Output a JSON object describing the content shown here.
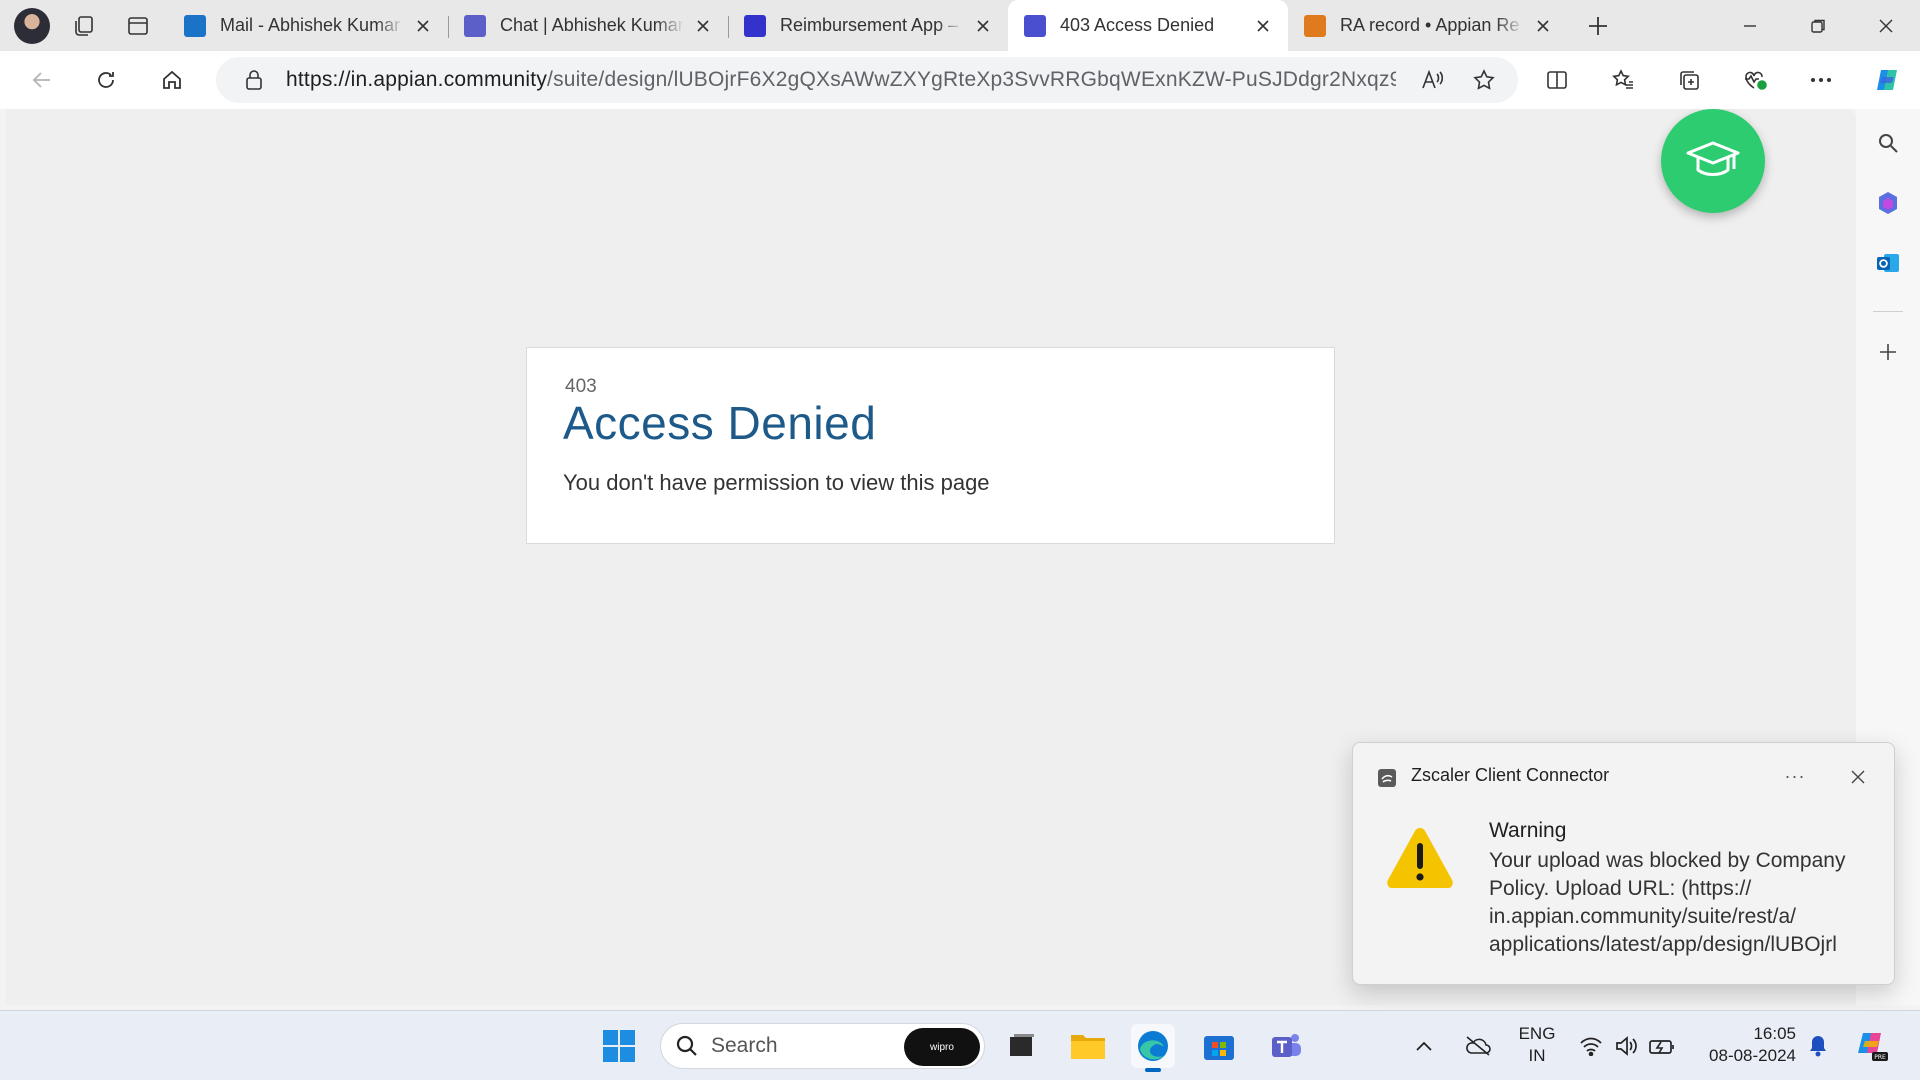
{
  "browser": {
    "tabs": [
      {
        "title": "Mail - Abhishek Kumar",
        "icon": "outlook-icon",
        "color": "#1a73c7"
      },
      {
        "title": "Chat | Abhishek Kumar",
        "icon": "teams-icon",
        "color": "#5b5fc7"
      },
      {
        "title": "Reimbursement App –",
        "icon": "appian-grid-icon",
        "color": "#3333cc"
      },
      {
        "title": "403 Access Denied",
        "icon": "appian-page-icon",
        "color": "#4a4fcf"
      },
      {
        "title": "RA record • Appian Re",
        "icon": "appian-record-icon",
        "color": "#e07a1f"
      }
    ],
    "active_tab_index": 3,
    "url_host": "https://in.appian.community",
    "url_path": "/suite/design/lUBOjrF6X2gQXsAWwZXYgRteXp3SvvRRGbqWExnKZW-PuSJDdgr2Nxqz90..."
  },
  "page": {
    "error_code": "403",
    "error_title": "Access Denied",
    "error_message": "You don't have permission to view this page"
  },
  "toast": {
    "app_name": "Zscaler Client Connector",
    "title": "Warning",
    "body": "Your upload was blocked by Company Policy. Upload URL: (https:// in.appian.community/suite/rest/a/ applications/latest/app/design/lUBOjrl"
  },
  "taskbar": {
    "search_placeholder": "Search",
    "search_brand": "wipro",
    "language_line1": "ENG",
    "language_line2": "IN",
    "time": "16:05",
    "date": "08-08-2024"
  },
  "colors": {
    "accent_green": "#2ecc71",
    "heading_blue": "#1d5a8a",
    "warning_yellow": "#f5c400"
  }
}
